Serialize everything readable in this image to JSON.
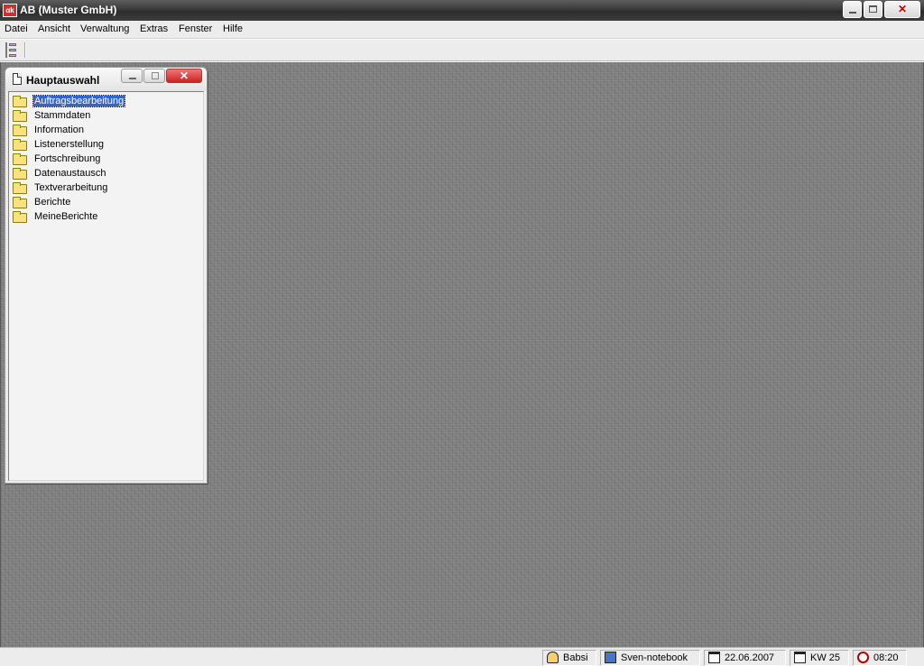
{
  "window": {
    "title": "AB (Muster GmbH)",
    "icon": "app-icon",
    "icon_text": "αk"
  },
  "menubar": {
    "items": [
      {
        "label": "Datei"
      },
      {
        "label": "Ansicht"
      },
      {
        "label": "Verwaltung"
      },
      {
        "label": "Extras"
      },
      {
        "label": "Fenster"
      },
      {
        "label": "Hilfe"
      }
    ]
  },
  "toolbar": {
    "tree_button_icon": "tree-view-icon"
  },
  "child_window": {
    "title": "Hauptauswahl",
    "close_glyph": "✕",
    "items": [
      {
        "label": "Auftragsbearbeitung",
        "selected": true
      },
      {
        "label": "Stammdaten"
      },
      {
        "label": "Information"
      },
      {
        "label": "Listenerstellung"
      },
      {
        "label": "Fortschreibung"
      },
      {
        "label": "Datenaustausch"
      },
      {
        "label": "Textverarbeitung"
      },
      {
        "label": "Berichte"
      },
      {
        "label": "MeineBerichte"
      }
    ]
  },
  "statusbar": {
    "user": "Babsi",
    "computer": "Sven-notebook",
    "date": "22.06.2007",
    "week": "KW 25",
    "time": "08:20"
  },
  "colors": {
    "selection": "#3366cc",
    "folder": "#f8e279",
    "desktop": "#7e7e7e"
  }
}
